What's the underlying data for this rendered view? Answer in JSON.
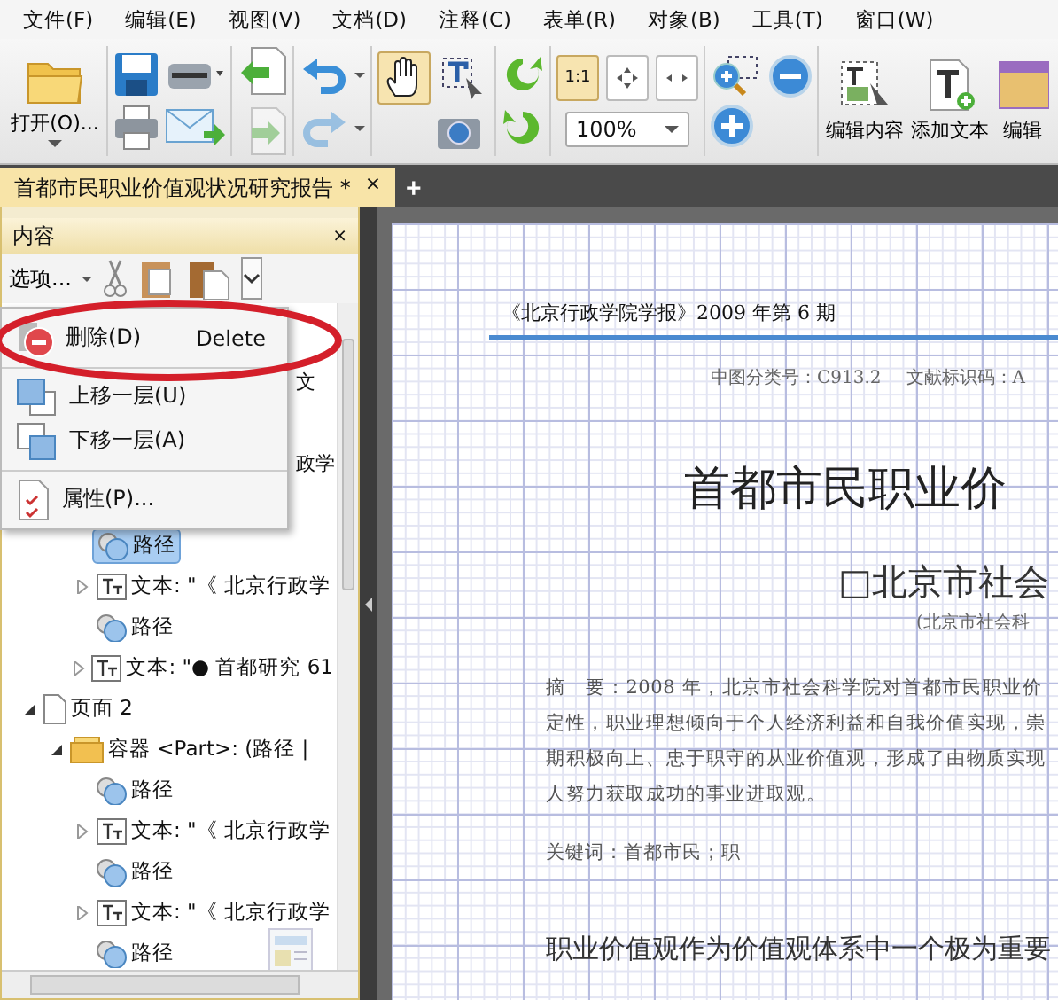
{
  "menu": [
    "文件(F)",
    "编辑(E)",
    "视图(V)",
    "文档(D)",
    "注释(C)",
    "表单(R)",
    "对象(B)",
    "工具(T)",
    "窗口(W)"
  ],
  "toolbar": {
    "open_label": "打开(O)...",
    "pages": [
      {
        "kind": "insert",
        "disabled": false
      },
      {
        "kind": "extract",
        "disabled": true
      }
    ],
    "history": [
      {
        "kind": "undo",
        "disabled": false
      },
      {
        "kind": "redo",
        "disabled": true
      }
    ],
    "tools": [
      {
        "kind": "hand",
        "selected": true
      },
      {
        "kind": "select-text",
        "selected": false
      }
    ],
    "view_modes": [
      {
        "kind": "actual",
        "label": "1:1",
        "selected": true
      },
      {
        "kind": "fit-page",
        "selected": false
      },
      {
        "kind": "fit-width",
        "selected": false
      }
    ],
    "zoom": "100%",
    "big_buttons": [
      {
        "kind": "edit",
        "label": "编辑内容"
      },
      {
        "kind": "add-text",
        "label": "添加文本"
      },
      {
        "kind": "form",
        "label": "编辑"
      }
    ]
  },
  "tabs": [
    {
      "label": "首都市民职业价值观状况研究报告 *",
      "selected": true,
      "close": "×"
    }
  ],
  "new_tab": "+",
  "panel": {
    "title": "内容",
    "close": "×",
    "options": "选项...",
    "covered_fragments": [
      "文",
      "政学"
    ],
    "tree": [
      {
        "children": [
          {
            "children": [
              {
                "kind": "path",
                "label": "路径",
                "selected": true
              },
              {
                "kind": "text",
                "label": "文本: \"《 北京行政学",
                "selected": false,
                "expanded": false
              },
              {
                "kind": "path",
                "label": "路径",
                "selected": false
              },
              {
                "kind": "text",
                "label": "文本: \"● 首都研究 61",
                "selected": false,
                "expanded": false
              }
            ]
          }
        ]
      },
      {
        "kind": "page",
        "label": "页面 2",
        "selected": false,
        "expanded": true,
        "children": [
          {
            "kind": "container",
            "label": "容器 <Part>: (路径 |",
            "selected": false,
            "expanded": true,
            "children": [
              {
                "kind": "path",
                "label": "路径",
                "selected": false
              },
              {
                "kind": "text",
                "label": "文本: \"《 北京行政学",
                "selected": false,
                "expanded": false
              },
              {
                "kind": "path",
                "label": "路径",
                "selected": false
              },
              {
                "kind": "text",
                "label": "文本: \"《 北京行政学",
                "selected": false,
                "expanded": false
              },
              {
                "kind": "path",
                "label": "路径",
                "selected": false
              }
            ]
          }
        ]
      }
    ]
  },
  "context_menu": [
    {
      "kind": "delete",
      "label": "删除(D)",
      "shortcut": "Delete",
      "separator_before": false
    },
    {
      "kind": "up",
      "label": "上移一层(U)",
      "separator_before": true
    },
    {
      "kind": "down",
      "label": "下移一层(A)",
      "separator_before": false
    },
    {
      "kind": "props",
      "label": "属性(P)...",
      "separator_before": true
    }
  ],
  "document": {
    "journal": "《北京行政学院学报》2009 年第 6 期",
    "classification": "中图分类号：C913.2",
    "doc_code": "文献标识码：A",
    "title": "首都市民职业价",
    "author": "□北京市社会",
    "affiliation": "(北京市社会科",
    "abstract": [
      "摘　要：2008 年，北京市社会科学院对首都市民职业价",
      "定性，职业理想倾向于个人经济利益和自我价值实现，崇",
      "期积极向上、忠于职守的从业价值观，形成了由物质实现",
      "人努力获取成功的事业进取观。"
    ],
    "keywords": "关键词：首都市民；职",
    "body": "职业价值观作为价值观体系中一个极为重要"
  }
}
